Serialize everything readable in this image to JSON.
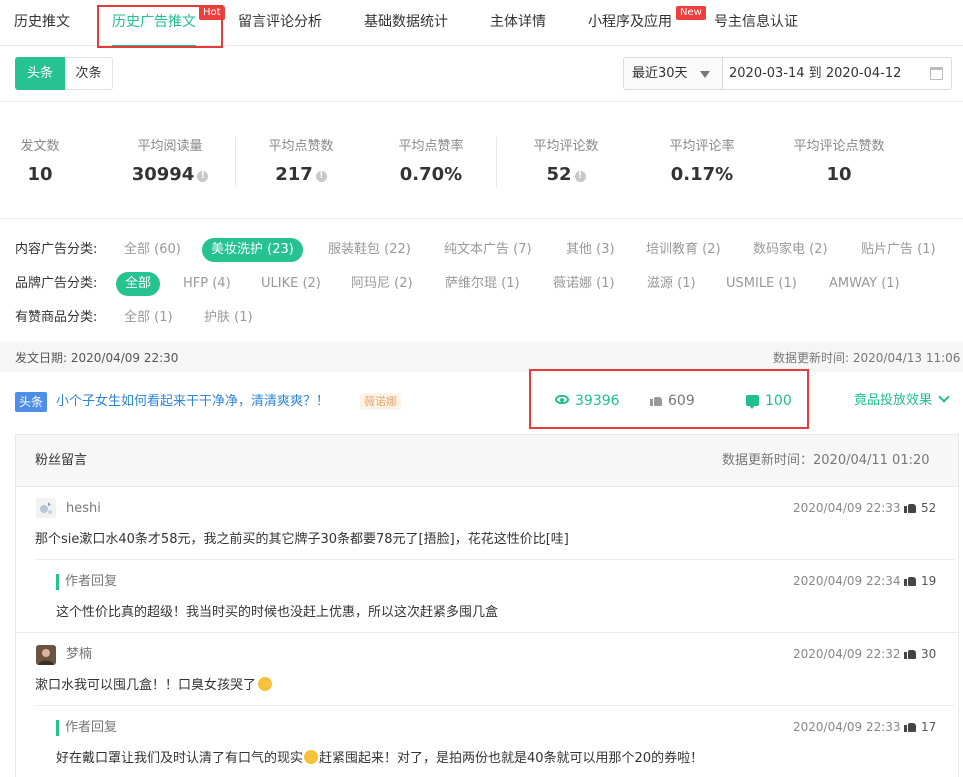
{
  "tabs": [
    {
      "label": "历史推文",
      "active": false
    },
    {
      "label": "历史广告推文",
      "active": true,
      "badge": "Hot"
    },
    {
      "label": "留言评论分析",
      "active": false
    },
    {
      "label": "基础数据统计",
      "active": false
    },
    {
      "label": "主体详情",
      "active": false
    },
    {
      "label": "小程序及应用",
      "active": false,
      "badge": "New"
    },
    {
      "label": "号主信息认证",
      "active": false
    }
  ],
  "segment": {
    "first": "头条",
    "second": "次条"
  },
  "range_select": {
    "label": "最近30天",
    "value": "2020-03-14 到 2020-04-12"
  },
  "stats": [
    {
      "label": "发文数",
      "value": "10"
    },
    {
      "label": "平均阅读量",
      "value": "30994"
    },
    {
      "label": "平均点赞数",
      "value": "217"
    },
    {
      "label": "平均点赞率",
      "value": "0.70%"
    },
    {
      "label": "平均评论数",
      "value": "52"
    },
    {
      "label": "平均评论率",
      "value": "0.17%"
    },
    {
      "label": "平均评论点赞数",
      "value": "10"
    }
  ],
  "filters": {
    "content": {
      "label": "内容广告分类:",
      "items": [
        "全部 (60)",
        "美妆洗护 (23)",
        "服装鞋包 (22)",
        "纯文本广告 (7)",
        "其他 (3)",
        "培训教育 (2)",
        "数码家电 (2)",
        "贴片广告 (1)"
      ]
    },
    "brand": {
      "label": "品牌广告分类:",
      "items": [
        "全部",
        "HFP (4)",
        "ULIKE (2)",
        "阿玛尼 (2)",
        "萨维尔琨 (1)",
        "薇诺娜 (1)",
        "滋源 (1)",
        "USMILE (1)",
        "AMWAY (1)"
      ]
    },
    "liked": {
      "label": "有赞商品分类:",
      "items": [
        "全部 (1)",
        "护肤 (1)"
      ]
    }
  },
  "post": {
    "date_label": "发文日期: 2020/04/09 22:30",
    "update_label": "数据更新时间: 2020/04/13 11:06",
    "position_tag": "头条",
    "title": "小个子女生如何看起来干干净净，清清爽爽？！",
    "brand_tag": "薇诺娜",
    "reads": "39396",
    "likes": "609",
    "comments": "100",
    "competitor_link": "竟品投放效果"
  },
  "comments_panel": {
    "title": "粉丝留言",
    "update": "数据更新时间：2020/04/11 01:20",
    "items": [
      {
        "user": "heshi",
        "time": "2020/04/09 22:33",
        "likes": "52",
        "text": "那个sie漱口水40条才58元，我之前买的其它牌子30条都要78元了[捂脸]，花花这性价比[哇]",
        "reply_label": "作者回复",
        "reply_time": "2020/04/09 22:34",
        "reply_likes": "19",
        "reply_text": "这个性价比真的超级！我当时买的时候也没赶上优惠，所以这次赶紧多囤几盒"
      },
      {
        "user": "梦楠",
        "time": "2020/04/09 22:32",
        "likes": "30",
        "text": "漱口水我可以囤几盒！！口臭女孩哭了",
        "reply_label": "作者回复",
        "reply_time": "2020/04/09 22:33",
        "reply_likes": "17",
        "reply_text_a": "好在戴口罩让我们及时认清了有口气的现实",
        "reply_text_b": "赶紧囤起来！对了，是拍两份也就是40条就可以用那个20的券啦！"
      }
    ]
  },
  "colors": {
    "accent": "#26c28f",
    "link": "#2f86d6",
    "highlight_box": "#e43b3b"
  }
}
